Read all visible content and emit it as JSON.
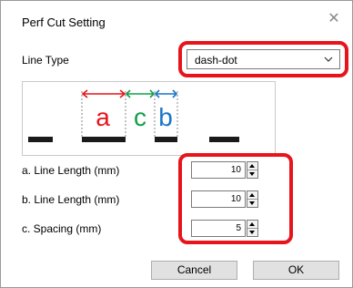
{
  "dialog": {
    "title": "Perf Cut Setting",
    "close_icon": "close-icon"
  },
  "line_type": {
    "label": "Line Type",
    "selected": "dash-dot",
    "dropdown_icon": "chevron-down-icon"
  },
  "preview": {
    "letters": [
      "a",
      "c",
      "b"
    ],
    "colors": {
      "a": "#e8141b",
      "c": "#12a04a",
      "b": "#1b74c8",
      "line": "#1a1a1a"
    }
  },
  "fields": [
    {
      "label": "a. Line Length (mm)",
      "value": "10"
    },
    {
      "label": "b. Line Length (mm)",
      "value": "10"
    },
    {
      "label": "c. Spacing (mm)",
      "value": "5"
    }
  ],
  "buttons": {
    "cancel": "Cancel",
    "ok": "OK"
  },
  "highlight_color": "#e8141b"
}
